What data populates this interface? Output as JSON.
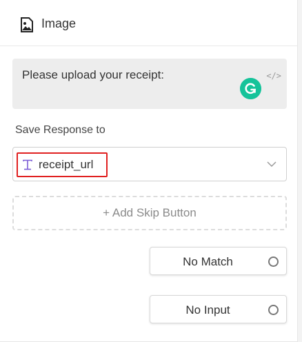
{
  "header": {
    "title": "Image",
    "icon": "image-icon"
  },
  "prompt": {
    "text": "Please upload your receipt:",
    "code_toggle": "</>",
    "grammarly_icon": "grammarly-icon"
  },
  "save_response": {
    "label": "Save Response to",
    "variable": "receipt_url",
    "variable_icon": "text-variable-icon"
  },
  "skip_button": {
    "label": "+ Add Skip Button"
  },
  "ports": [
    {
      "label": "No Match"
    },
    {
      "label": "No Input"
    }
  ],
  "colors": {
    "accent_highlight": "#e02020",
    "variable_icon": "#7b5cd6",
    "grammarly": "#15c39a",
    "prompt_bg": "#ededed"
  }
}
